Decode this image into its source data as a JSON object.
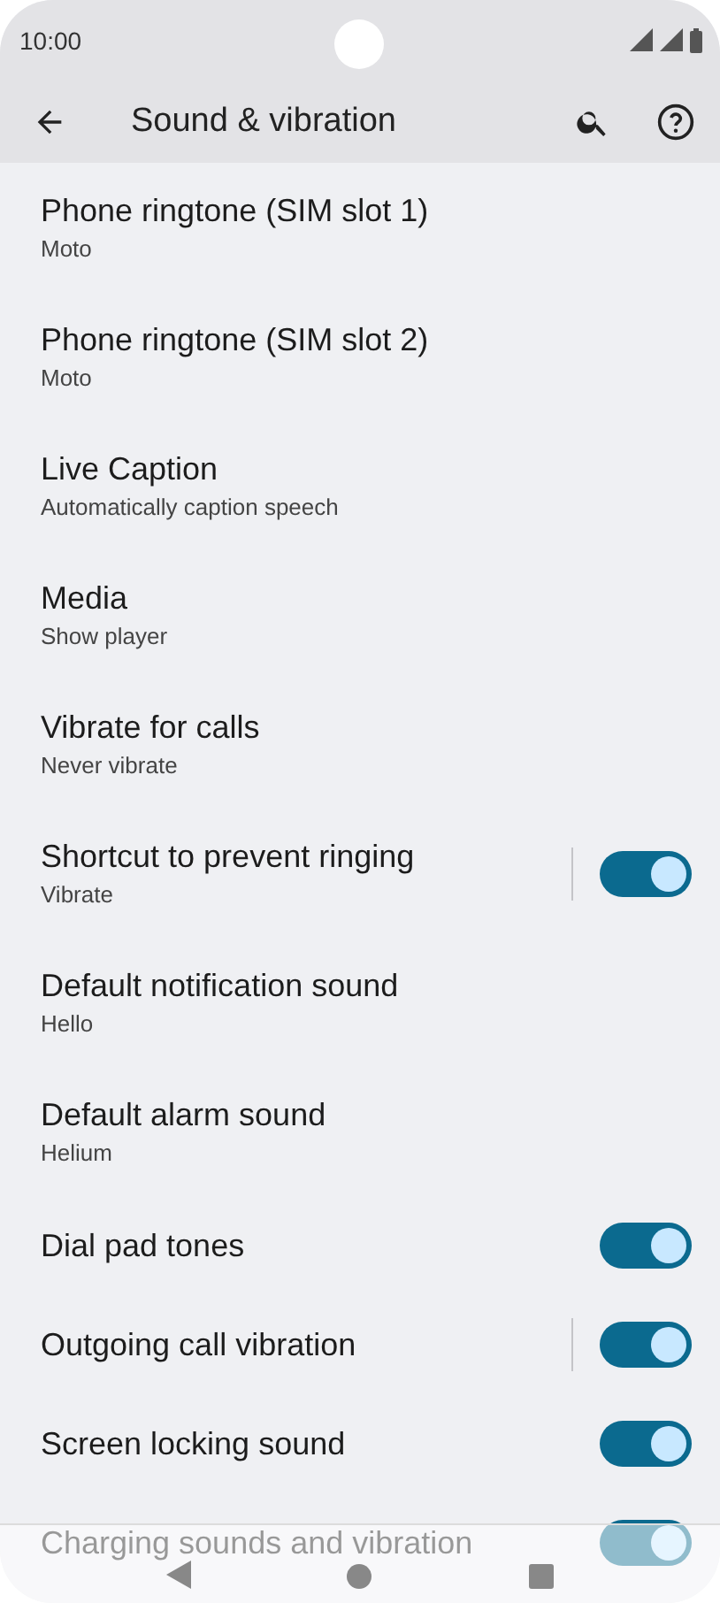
{
  "status_bar": {
    "time": "10:00"
  },
  "toolbar": {
    "title": "Sound & vibration"
  },
  "settings": [
    {
      "kind": "text",
      "title": "Phone ringtone (SIM slot 1)",
      "subtitle": "Moto"
    },
    {
      "kind": "text",
      "title": "Phone ringtone (SIM slot 2)",
      "subtitle": "Moto"
    },
    {
      "kind": "text",
      "title": "Live Caption",
      "subtitle": "Automatically caption speech"
    },
    {
      "kind": "text",
      "title": "Media",
      "subtitle": "Show player"
    },
    {
      "kind": "text",
      "title": "Vibrate for calls",
      "subtitle": "Never vibrate"
    },
    {
      "kind": "toggle",
      "title": "Shortcut to prevent ringing",
      "subtitle": "Vibrate",
      "on": true,
      "separator": true
    },
    {
      "kind": "text",
      "title": "Default notification sound",
      "subtitle": "Hello"
    },
    {
      "kind": "text",
      "title": "Default alarm sound",
      "subtitle": "Helium"
    },
    {
      "kind": "toggle",
      "title": "Dial pad tones",
      "on": true,
      "separator": false
    },
    {
      "kind": "toggle",
      "title": "Outgoing call vibration",
      "on": true,
      "separator": true
    },
    {
      "kind": "toggle",
      "title": "Screen locking sound",
      "on": true,
      "separator": false
    },
    {
      "kind": "toggle",
      "title": "Charging sounds and vibration",
      "on": true,
      "separator": false
    }
  ]
}
